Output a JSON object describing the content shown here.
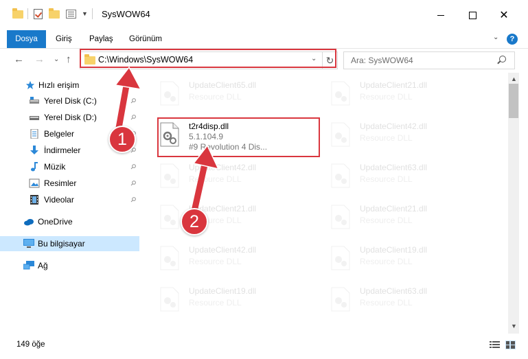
{
  "window": {
    "title": "SysWOW64",
    "controls": {
      "minimize": "",
      "maximize": "",
      "close": "✕"
    }
  },
  "ribbon": {
    "tabs": [
      "Dosya",
      "Giriş",
      "Paylaş",
      "Görünüm"
    ],
    "expand": "⌄",
    "help": "?"
  },
  "nav": {
    "back": "←",
    "forward": "→",
    "recent": "⌄",
    "up": "↑",
    "address": "C:\\Windows\\SysWOW64",
    "address_dropdown": "⌄",
    "refresh": "↻",
    "search_placeholder": "Ara: SysWOW64"
  },
  "sidebar": {
    "items": [
      {
        "label": "Hızlı erişim",
        "icon": "star-icon"
      },
      {
        "label": "Yerel Disk (C:)",
        "icon": "drive-icon",
        "pinned": true
      },
      {
        "label": "Yerel Disk (D:)",
        "icon": "drive-icon",
        "pinned": true
      },
      {
        "label": "Belgeler",
        "icon": "documents-icon",
        "pinned": true
      },
      {
        "label": "İndirmeler",
        "icon": "downloads-icon",
        "pinned": true
      },
      {
        "label": "Müzik",
        "icon": "music-icon",
        "pinned": true
      },
      {
        "label": "Resimler",
        "icon": "pictures-icon",
        "pinned": true
      },
      {
        "label": "Videolar",
        "icon": "videos-icon",
        "pinned": true
      },
      {
        "label": "OneDrive",
        "icon": "cloud-icon"
      },
      {
        "label": "Bu bilgisayar",
        "icon": "computer-icon",
        "selected": true
      },
      {
        "label": "Ağ",
        "icon": "network-icon"
      }
    ],
    "pin_glyph": "📌"
  },
  "files": {
    "selected": {
      "name": "t2r4disp.dll",
      "version": "5.1.104.9",
      "description": "#9 Revolution 4 Dis..."
    },
    "left_column": [
      {
        "name": "UpdateClient65.dll",
        "type": "Resource DLL"
      },
      {
        "name": "UpdateClient42.dll",
        "type": "Resource DLL"
      },
      {
        "name": "UpdateClient21.dll",
        "type": "Resource DLL"
      },
      {
        "name": "UpdateClient42.dll",
        "type": "Resource DLL"
      },
      {
        "name": "UpdateClient19.dll",
        "type": "Resource DLL"
      }
    ],
    "right_column": [
      {
        "name": "UpdateClient21.dll",
        "type": "Resource DLL"
      },
      {
        "name": "UpdateClient42.dll",
        "type": "Resource DLL"
      },
      {
        "name": "UpdateClient63.dll",
        "type": "Resource DLL"
      },
      {
        "name": "UpdateClient21.dll",
        "type": "Resource DLL"
      },
      {
        "name": "UpdateClient19.dll",
        "type": "Resource DLL"
      },
      {
        "name": "UpdateClient63.dll",
        "type": "Resource DLL"
      }
    ]
  },
  "status": {
    "item_count": "149 öğe"
  },
  "annotations": {
    "step1": "1",
    "step2": "2",
    "color": "#d9363e"
  },
  "colors": {
    "accent": "#1979ca",
    "selection": "#cce8ff",
    "highlight": "#d9363e"
  }
}
